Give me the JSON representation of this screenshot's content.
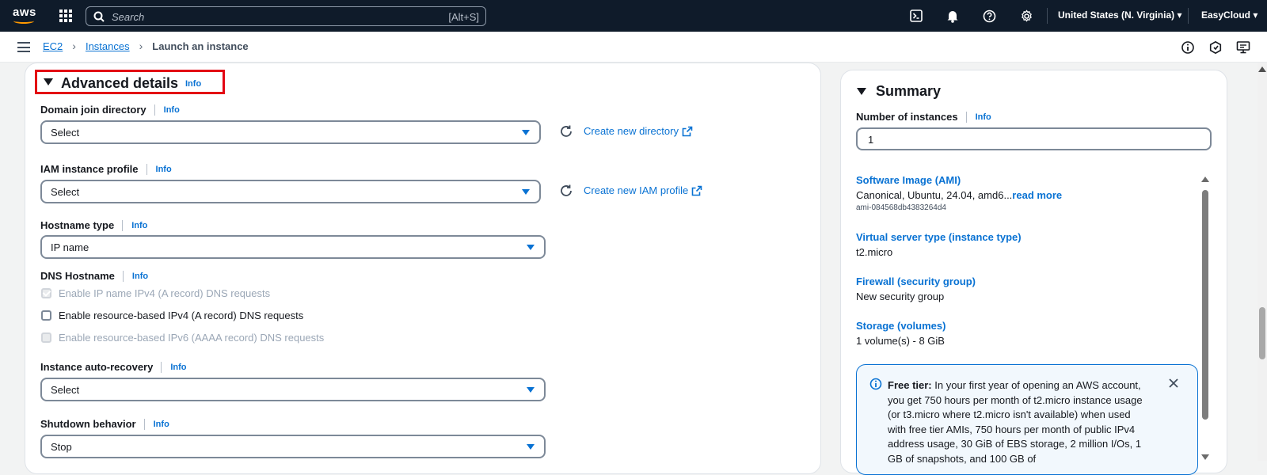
{
  "topbar": {
    "logo_text": "aws",
    "search_placeholder": "Search",
    "search_shortcut": "[Alt+S]",
    "region": "United States (N. Virginia)",
    "account": "EasyCloud"
  },
  "breadcrumb": {
    "items": [
      "EC2",
      "Instances"
    ],
    "current": "Launch an instance"
  },
  "advanced": {
    "title": "Advanced details",
    "info": "Info",
    "fields": {
      "domain_join": {
        "label": "Domain join directory",
        "info": "Info",
        "value": "Select",
        "create_link": "Create new directory"
      },
      "iam_profile": {
        "label": "IAM instance profile",
        "info": "Info",
        "value": "Select",
        "create_link": "Create new IAM profile"
      },
      "hostname_type": {
        "label": "Hostname type",
        "info": "Info",
        "value": "IP name"
      },
      "dns_hostname": {
        "label": "DNS Hostname",
        "info": "Info",
        "options": [
          {
            "label": "Enable IP name IPv4 (A record) DNS requests",
            "checked": true,
            "disabled": true
          },
          {
            "label": "Enable resource-based IPv4 (A record) DNS requests",
            "checked": false,
            "disabled": false
          },
          {
            "label": "Enable resource-based IPv6 (AAAA record) DNS requests",
            "checked": false,
            "disabled": true
          }
        ]
      },
      "auto_recovery": {
        "label": "Instance auto-recovery",
        "info": "Info",
        "value": "Select"
      },
      "shutdown": {
        "label": "Shutdown behavior",
        "info": "Info",
        "value": "Stop"
      }
    }
  },
  "summary": {
    "title": "Summary",
    "num_instances_label": "Number of instances",
    "num_instances_info": "Info",
    "num_instances_value": "1",
    "ami_label": "Software Image (AMI)",
    "ami_value": "Canonical, Ubuntu, 24.04, amd6...",
    "ami_read_more": "read more",
    "ami_id": "ami-084568db4383264d4",
    "instance_type_label": "Virtual server type (instance type)",
    "instance_type_value": "t2.micro",
    "firewall_label": "Firewall (security group)",
    "firewall_value": "New security group",
    "storage_label": "Storage (volumes)",
    "storage_value": "1 volume(s) - 8 GiB",
    "free_tier_heading": "Free tier:",
    "free_tier_text": "In your first year of opening an AWS account, you get 750 hours per month of t2.micro instance usage (or t3.micro where t2.micro isn't available) when used with free tier AMIs, 750 hours per month of public IPv4 address usage, 30 GiB of EBS storage, 2 million I/Os, 1 GB of snapshots, and 100 GB of"
  },
  "colors": {
    "link": "#0972d3",
    "topbar": "#0f1b2a",
    "highlight": "#e30613"
  }
}
